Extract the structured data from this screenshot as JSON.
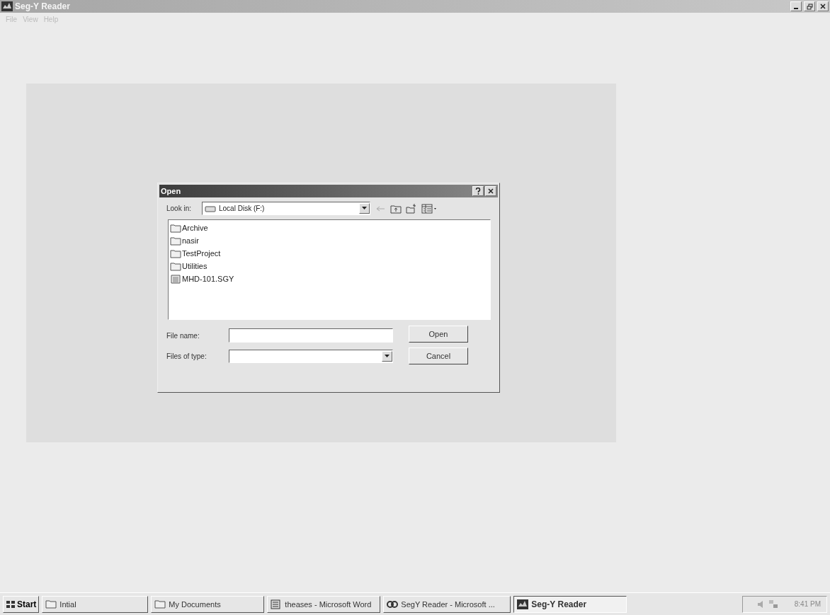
{
  "window": {
    "title": "Seg-Y Reader"
  },
  "menu": [
    "File",
    "View",
    "Help"
  ],
  "dialog": {
    "title": "Open",
    "look_in_label": "Look in:",
    "look_in_value": "Local Disk (F:)",
    "files": [
      {
        "name": "Archive",
        "kind": "folder"
      },
      {
        "name": "nasir",
        "kind": "folder"
      },
      {
        "name": "TestProject",
        "kind": "folder"
      },
      {
        "name": "Utilities",
        "kind": "folder"
      },
      {
        "name": "MHD-101.SGY",
        "kind": "file"
      }
    ],
    "file_name_label": "File name:",
    "files_of_type_label": "Files of type:",
    "buttons": [
      "Open",
      "Cancel"
    ]
  },
  "taskbar": {
    "start": "Start",
    "items": [
      {
        "label": "Intial",
        "kind": "folder",
        "selected": false
      },
      {
        "label": "My Documents",
        "kind": "folder",
        "selected": false
      },
      {
        "label": "theases - Microsoft Word",
        "kind": "word",
        "selected": false
      },
      {
        "label": "SegY Reader - Microsoft ...",
        "kind": "link",
        "selected": false
      },
      {
        "label": "Seg-Y Reader",
        "kind": "app",
        "selected": true
      }
    ],
    "clock": "8:41 PM"
  }
}
